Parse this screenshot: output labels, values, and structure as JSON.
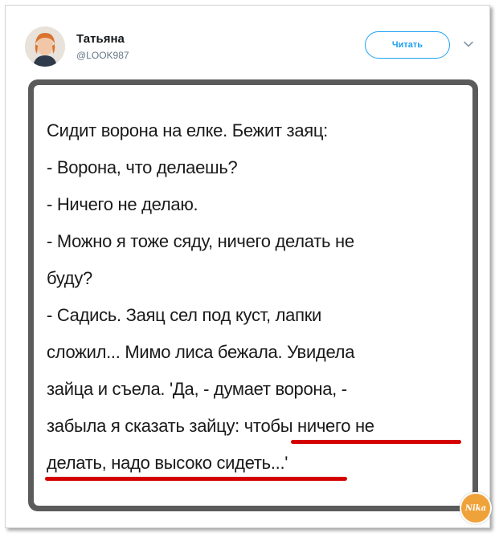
{
  "tweet": {
    "author_name": "Татьяна",
    "author_handle": "@LOOK987",
    "follow_label": "Читать",
    "more_icon": "chevron-down-icon",
    "avatar_icon": "user-avatar"
  },
  "joke": {
    "lines": [
      "Сидит ворона на елке. Бежит заяц:",
      "- Ворона, что делаешь?",
      "- Ничего не делаю.",
      "- Можно я тоже сяду, ничего делать не",
      "буду?",
      "- Садись. Заяц сел под куст, лапки",
      "сложил... Мимо лиса бежала. Увидела",
      "зайца и съела. 'Да, - думает ворона, -",
      "забыла я сказать зайцу: чтобы ничего не",
      "делать, надо высоко сидеть...'"
    ],
    "highlight_color": "#d40000"
  },
  "watermark": {
    "label": "Nika"
  },
  "colors": {
    "accent": "#1da1f2",
    "frame": "#5b5b5b"
  }
}
